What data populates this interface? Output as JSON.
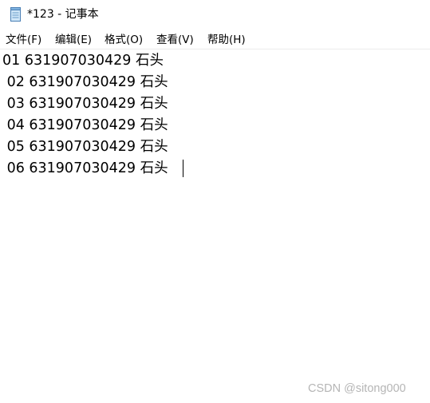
{
  "window": {
    "title": "*123 - 记事本",
    "icon": "notepad-icon"
  },
  "menu": {
    "items": [
      {
        "label": "文件(F)"
      },
      {
        "label": "编辑(E)"
      },
      {
        "label": "格式(O)"
      },
      {
        "label": "查看(V)"
      },
      {
        "label": "帮助(H)"
      }
    ]
  },
  "editor": {
    "lines": [
      "01 631907030429 石头",
      " 02 631907030429 石头",
      " 03 631907030429 石头",
      " 04 631907030429 石头",
      " 05 631907030429 石头",
      " 06 631907030429 石头"
    ]
  },
  "watermark": {
    "text": "CSDN @sitong000"
  },
  "colors": {
    "background": "#ffffff",
    "text": "#000000",
    "watermark": "#b5b5b5",
    "separator": "#ececec"
  }
}
